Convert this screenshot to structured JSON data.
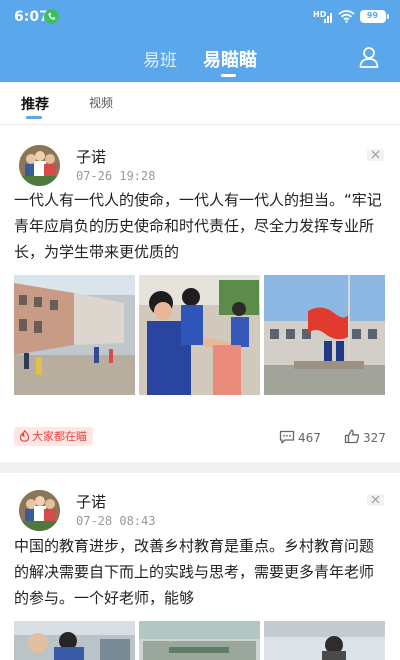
{
  "status": {
    "time": "6:07",
    "network": "HD",
    "battery": "99"
  },
  "nav": {
    "tab_class": "易班",
    "tab_mm": "易瞄瞄"
  },
  "subtabs": {
    "recommended": "推荐",
    "video": "视频"
  },
  "posts": [
    {
      "author": "子诺",
      "time": "07-26 19:28",
      "text": "一代人有一代人的使命，一代人有一代人的担当。“牢记青年应肩负的历史使命和时代责任，尽全力发挥专业所长，为学生带来更优质的",
      "badge": "大家都在瞄",
      "comments": "467",
      "likes": "327"
    },
    {
      "author": "子诺",
      "time": "07-28 08:43",
      "text": "中国的教育进步，改善乡村教育是重点。乡村教育问题的解决需要自下而上的实践与思考，需要更多青年老师的参与。一个好老师，能够"
    }
  ],
  "colors": {
    "brand": "#5aa7ec",
    "hot": "#e8453c",
    "hot_bg": "#fde6e3"
  },
  "icons": {
    "call": "phone-icon",
    "signal": "signal-icon",
    "wifi": "wifi-icon",
    "battery": "battery-icon",
    "user": "user-icon",
    "close": "close-icon",
    "fire": "fire-icon",
    "comment": "comment-icon",
    "like": "like-icon"
  }
}
